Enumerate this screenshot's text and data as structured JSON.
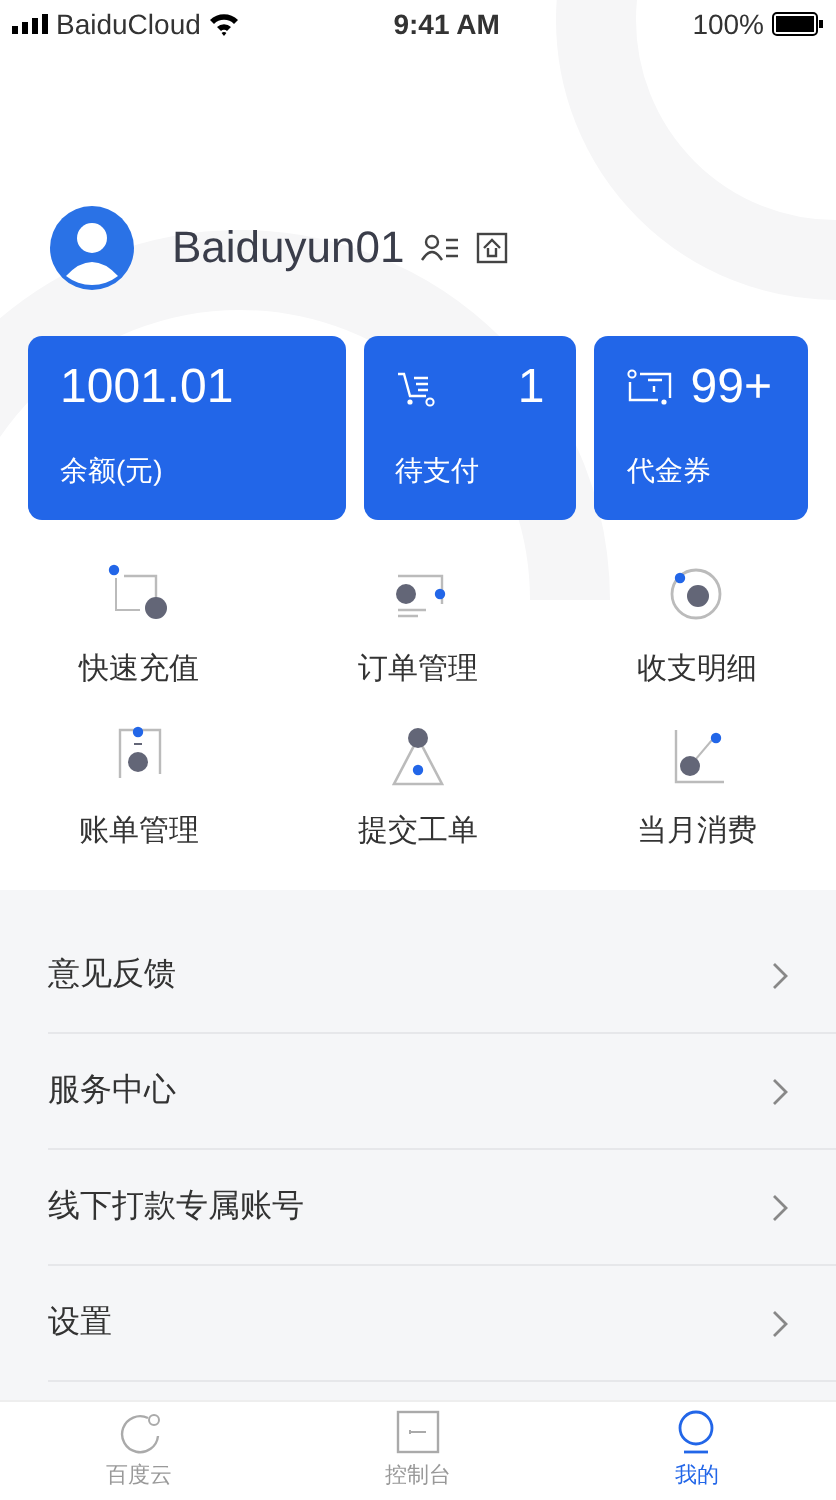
{
  "status_bar": {
    "carrier": "BaiduCloud",
    "time": "9:41 AM",
    "battery": "100%"
  },
  "profile": {
    "username": "Baiduyun01"
  },
  "cards": [
    {
      "kind": "balance",
      "value": "1001.01",
      "label": "余额(元)"
    },
    {
      "kind": "count",
      "value": "1",
      "label": "待支付"
    },
    {
      "kind": "count",
      "value": "99+",
      "label": "代金券"
    }
  ],
  "shortcuts": [
    {
      "label": "快速充值"
    },
    {
      "label": "订单管理"
    },
    {
      "label": "收支明细"
    },
    {
      "label": "账单管理"
    },
    {
      "label": "提交工单"
    },
    {
      "label": "当月消费"
    }
  ],
  "menu": [
    {
      "label": "意见反馈"
    },
    {
      "label": "服务中心"
    },
    {
      "label": "线下打款专属账号"
    },
    {
      "label": "设置"
    }
  ],
  "tab_bar": [
    {
      "label": "百度云",
      "selected": false
    },
    {
      "label": "控制台",
      "selected": false
    },
    {
      "label": "我的",
      "selected": true
    }
  ]
}
